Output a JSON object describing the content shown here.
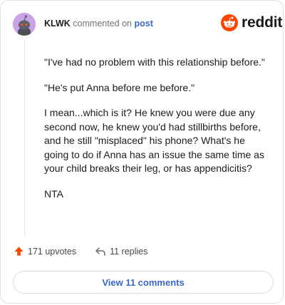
{
  "comment": {
    "username": "KLWK",
    "commented_on_text": "commented on",
    "post_link": "post",
    "paragraphs": [
      "\"I've had no problem with this relationship before.\"",
      "\"He's put Anna before me before.\"",
      "I mean...which is it? He knew you were due any second now, he knew you'd had stillbirths before, and he still \"misplaced\" his phone? What's he going to do if Anna has an issue the same time as your child breaks their leg, or has appendicitis?",
      "NTA"
    ]
  },
  "brand": {
    "name": "reddit",
    "accent": "#ff4500"
  },
  "actions": {
    "upvotes_label": "171 upvotes",
    "replies_label": "11 replies",
    "upvote_color": "#ff4500"
  },
  "footer": {
    "view_comments_label": "View 11 comments"
  }
}
